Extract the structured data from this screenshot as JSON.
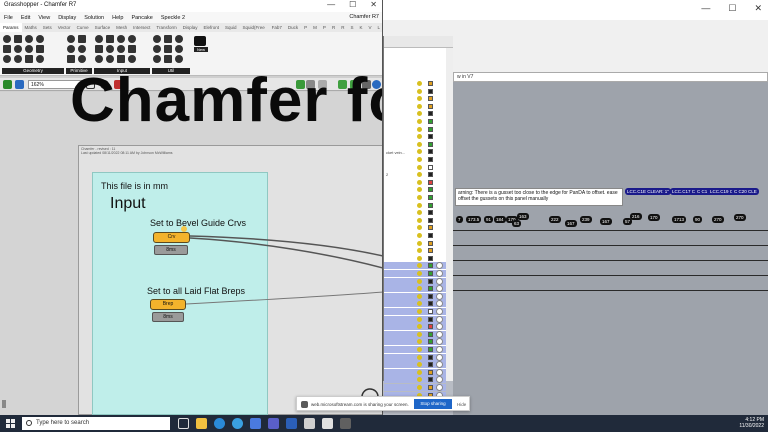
{
  "grasshopper": {
    "window_title": "Grasshopper - Chamfer R7",
    "doc_name": "Chamfer R7",
    "menu": [
      "File",
      "Edit",
      "View",
      "Display",
      "Solution",
      "Help",
      "Pancake",
      "Speckle 2"
    ],
    "tabs": [
      "Params",
      "Maths",
      "Sets",
      "Vector",
      "Curve",
      "Surface",
      "Mesh",
      "Intersect",
      "Transform",
      "Display",
      "Elefront",
      "Squid",
      "Squid(Free edition)",
      "Fab7",
      "Duck",
      "P",
      "M",
      "P",
      "R",
      "R",
      "S",
      "K",
      "V",
      "L"
    ],
    "active_tab": "Params",
    "ribbon_groups": [
      "Geometry",
      "Primitive",
      "Input",
      "Util"
    ],
    "ribbon_new_label": "New",
    "zoom": "162%",
    "canvas": {
      "big_title": "Chamfer fo",
      "group_name_line1": "Chamfer - revised : 11",
      "group_name_line2": "Last updated 08/11/2022 08:11 AM by Johnson McWilliams",
      "file_units": "This file is in mm",
      "input_header": "Input",
      "input1_label": "Set to Bevel Guide Crvs",
      "input1_component": "Crv",
      "input1_timing": "8ms",
      "input2_label": "Set to all Laid Flat Breps",
      "input2_component": "Brep",
      "input2_timing": "8ms"
    }
  },
  "rhino": {
    "viewport_tab": "w in V7",
    "layer_item_fragment": "cket vein...",
    "layer_item_fragment2": "2"
  },
  "warning": {
    "text": "arning: There is a gusset too close to the edge for PanDA to offset. ease offset the gussets on this panel manually"
  },
  "bubbles": [
    "LCC.C1E CLEAR: 1\"",
    "LCC.C17 CLEAR: 0\"",
    "C C1 LEAR: 4\"",
    "LCC.C19 CLEAR: 4\"",
    "C C20 CLE",
    "7",
    "173.5",
    "91",
    "184",
    "170",
    "163",
    "63",
    "222",
    "167",
    "239",
    "167",
    "216",
    "57",
    "170",
    "1713",
    "90",
    "270",
    "270"
  ],
  "share_bar": {
    "text": "web.microsoftstream.com is sharing your screen.",
    "stop_button": "Stop sharing",
    "hide_button": "Hide"
  },
  "taskbar": {
    "search_placeholder": "Type here to search",
    "time": "4:12 PM",
    "date": "11/30/2022"
  },
  "colors": {
    "cyan_group": "#bfeeea",
    "component_orange": "#f3b32c",
    "layer_selected": "#a9b4e6",
    "taskbar": "#202a3a",
    "share_blue": "#1e66c8"
  }
}
